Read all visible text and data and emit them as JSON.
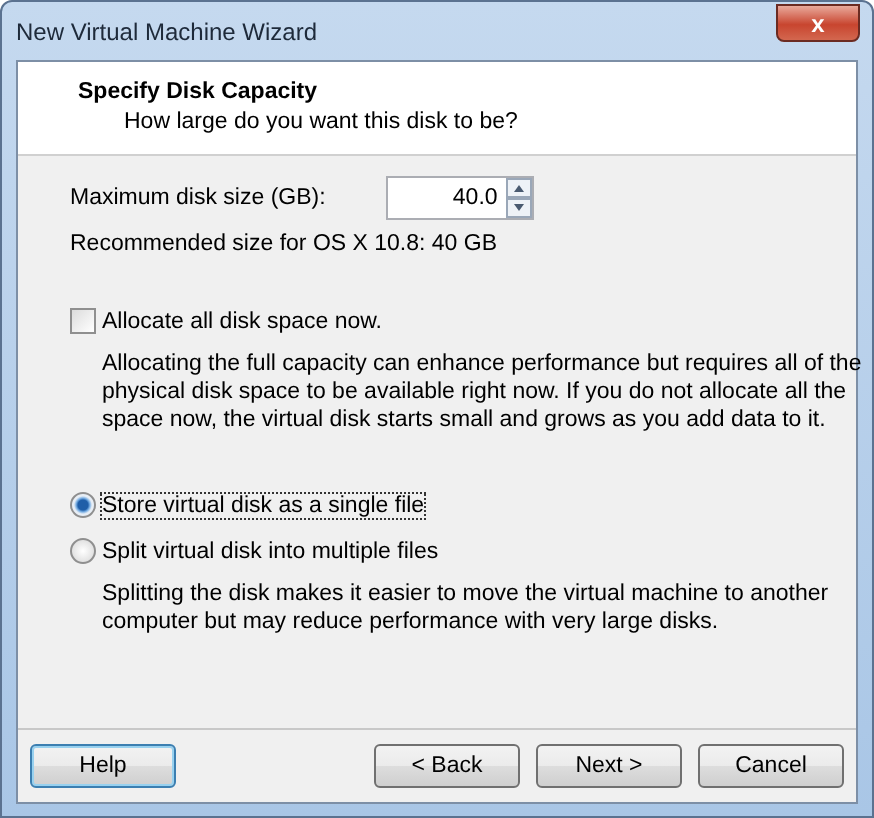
{
  "window": {
    "title": "New Virtual Machine Wizard",
    "close": "x"
  },
  "header": {
    "title": "Specify Disk Capacity",
    "subtitle": "How large do you want this disk to be?"
  },
  "disk_size": {
    "label": "Maximum disk size (GB):",
    "value": "40.0"
  },
  "recommended": "Recommended size for OS X 10.8: 40 GB",
  "allocate": {
    "label": "Allocate all disk space now.",
    "checked": false,
    "description": "Allocating the full capacity can enhance performance but requires all of the physical disk space to be available right now. If you do not allocate all the space now, the virtual disk starts small and grows as you add data to it."
  },
  "storage_options": [
    {
      "label": "Store virtual disk as a single file",
      "selected": true
    },
    {
      "label": "Split virtual disk into multiple files",
      "selected": false,
      "description": "Splitting the disk makes it easier to move the virtual machine to another computer but may reduce performance with very large disks."
    }
  ],
  "buttons": [
    {
      "label": "Help",
      "focused": true
    },
    {
      "label": "< Back",
      "focused": false
    },
    {
      "label": "Next >",
      "focused": false
    },
    {
      "label": "Cancel",
      "focused": false
    }
  ]
}
